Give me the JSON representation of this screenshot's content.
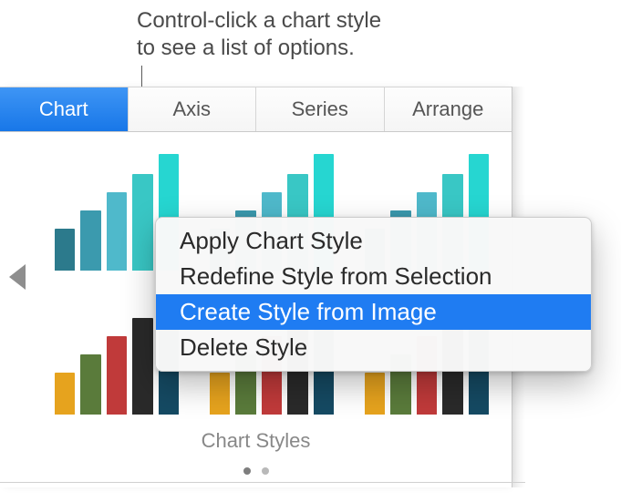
{
  "callout": "Control-click a chart style\nto see a list of options.",
  "tabs": [
    {
      "label": "Chart",
      "active": true
    },
    {
      "label": "Axis",
      "active": false
    },
    {
      "label": "Series",
      "active": false
    },
    {
      "label": "Arrange",
      "active": false
    }
  ],
  "styles": {
    "section_label": "Chart Styles",
    "thumbs_row1": [
      {
        "colors": [
          "#2c7a8c",
          "#3b9aae",
          "#4fb9cb",
          "#39c7c5",
          "#26d6d1"
        ],
        "heights": [
          46,
          66,
          86,
          106,
          128
        ]
      },
      {
        "colors": [
          "#2c7a8c",
          "#3b9aae",
          "#4fb9cb",
          "#39c7c5",
          "#26d6d1"
        ],
        "heights": [
          46,
          66,
          86,
          106,
          128
        ]
      },
      {
        "colors": [
          "#2c7a8c",
          "#3b9aae",
          "#4fb9cb",
          "#39c7c5",
          "#26d6d1"
        ],
        "heights": [
          46,
          66,
          86,
          106,
          128
        ]
      }
    ],
    "thumbs_row2": [
      {
        "colors": [
          "#e6a31e",
          "#5a7b3b",
          "#c03a3a",
          "#2a2a2a",
          "#154a63"
        ],
        "heights": [
          46,
          66,
          86,
          106,
          128
        ]
      },
      {
        "colors": [
          "#e6a31e",
          "#5a7b3b",
          "#c03a3a",
          "#2a2a2a",
          "#154a63"
        ],
        "heights": [
          46,
          66,
          86,
          106,
          128
        ]
      },
      {
        "colors": [
          "#e6a31e",
          "#5a7b3b",
          "#c03a3a",
          "#2a2a2a",
          "#154a63"
        ],
        "heights": [
          46,
          66,
          86,
          106,
          128
        ]
      }
    ]
  },
  "context_menu": {
    "items": [
      {
        "label": "Apply Chart Style",
        "highlight": false
      },
      {
        "label": "Redefine Style from Selection",
        "highlight": false
      },
      {
        "label": "Create Style from Image",
        "highlight": true
      },
      {
        "label": "Delete Style",
        "highlight": false
      }
    ]
  }
}
